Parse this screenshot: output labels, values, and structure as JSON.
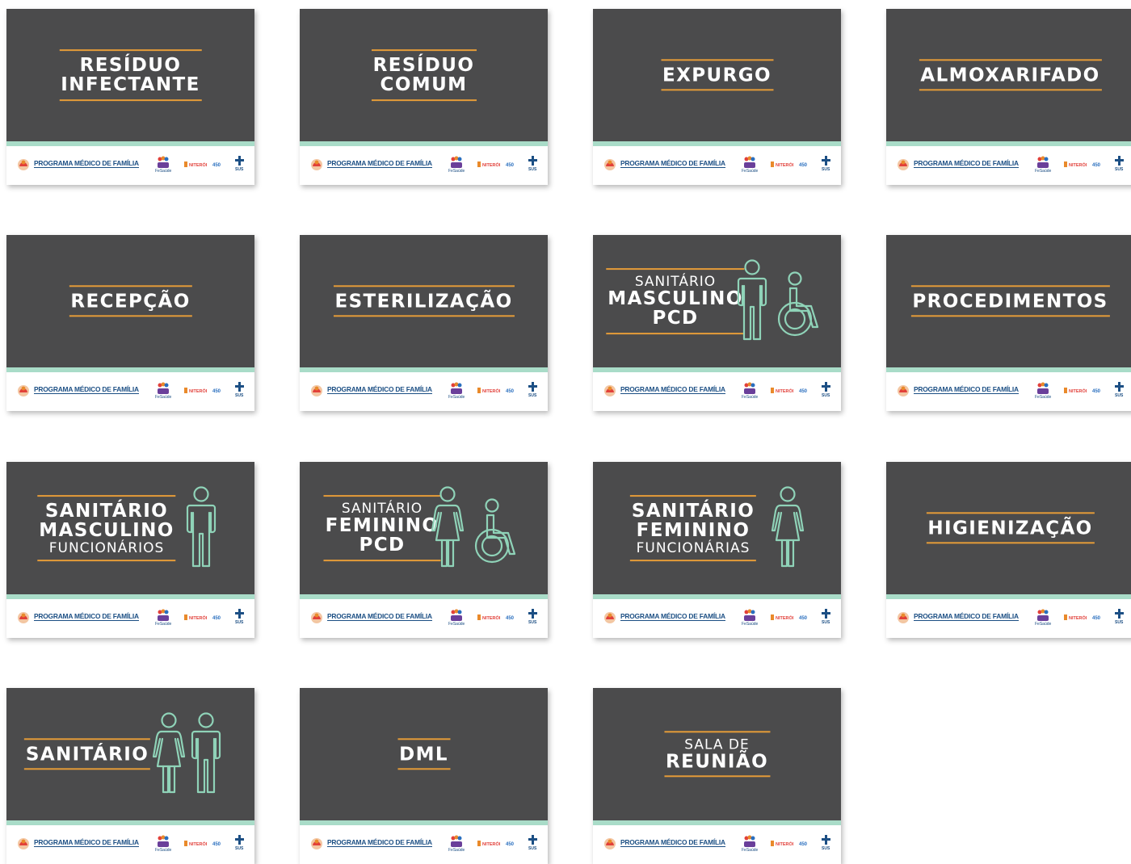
{
  "footer": {
    "program_label": "PROGRAMA MÉDICO DE FAMÍLIA",
    "fesaude_label": "FeSaúde",
    "niteroi_label": "NITERÓI",
    "anniversary_label": "450",
    "sus_label": "SUS"
  },
  "signs": [
    {
      "lines": [
        {
          "text": "RESÍDUO",
          "style": "bold"
        },
        {
          "text": "INFECTANTE",
          "style": "bold"
        }
      ],
      "icons": []
    },
    {
      "lines": [
        {
          "text": "RESÍDUO",
          "style": "bold"
        },
        {
          "text": "COMUM",
          "style": "bold"
        }
      ],
      "icons": []
    },
    {
      "lines": [
        {
          "text": "EXPURGO",
          "style": "bold"
        }
      ],
      "icons": []
    },
    {
      "lines": [
        {
          "text": "ALMOXARIFADO",
          "style": "bold"
        }
      ],
      "icons": []
    },
    {
      "lines": [
        {
          "text": "RECEPÇÃO",
          "style": "bold"
        }
      ],
      "icons": []
    },
    {
      "lines": [
        {
          "text": "ESTERILIZAÇÃO",
          "style": "bold"
        }
      ],
      "icons": []
    },
    {
      "lines": [
        {
          "text": "SANITÁRIO",
          "style": "light"
        },
        {
          "text": "MASCULINO",
          "style": "bold"
        },
        {
          "text": "PCD",
          "style": "bold"
        }
      ],
      "icons": [
        "male-icon",
        "wheelchair-icon"
      ]
    },
    {
      "lines": [
        {
          "text": "PROCEDIMENTOS",
          "style": "bold"
        }
      ],
      "icons": []
    },
    {
      "lines": [
        {
          "text": "SANITÁRIO",
          "style": "bold"
        },
        {
          "text": "MASCULINO",
          "style": "bold"
        },
        {
          "text": "FUNCIONÁRIOS",
          "style": "light"
        }
      ],
      "icons": [
        "male-icon"
      ]
    },
    {
      "lines": [
        {
          "text": "SANITÁRIO",
          "style": "light"
        },
        {
          "text": "FEMININO",
          "style": "bold"
        },
        {
          "text": "PCD",
          "style": "bold"
        }
      ],
      "icons": [
        "female-icon",
        "wheelchair-icon"
      ]
    },
    {
      "lines": [
        {
          "text": "SANITÁRIO",
          "style": "bold"
        },
        {
          "text": "FEMININO",
          "style": "bold"
        },
        {
          "text": "FUNCIONÁRIAS",
          "style": "light"
        }
      ],
      "icons": [
        "female-icon"
      ]
    },
    {
      "lines": [
        {
          "text": "HIGIENIZAÇÃO",
          "style": "bold"
        }
      ],
      "icons": []
    },
    {
      "lines": [
        {
          "text": "SANITÁRIO",
          "style": "bold"
        }
      ],
      "icons": [
        "female-icon",
        "male-icon"
      ]
    },
    {
      "lines": [
        {
          "text": "DML",
          "style": "bold"
        }
      ],
      "icons": []
    },
    {
      "lines": [
        {
          "text": "SALA DE",
          "style": "light"
        },
        {
          "text": "REUNIÃO",
          "style": "bold"
        }
      ],
      "icons": []
    }
  ],
  "colors": {
    "sign_background": "#4b4b4c",
    "rule_orange": "#e59c38",
    "mint_stripe": "#a9dcc8",
    "icon_stroke": "#8fd3b8",
    "brand_blue": "#1c4f84"
  }
}
